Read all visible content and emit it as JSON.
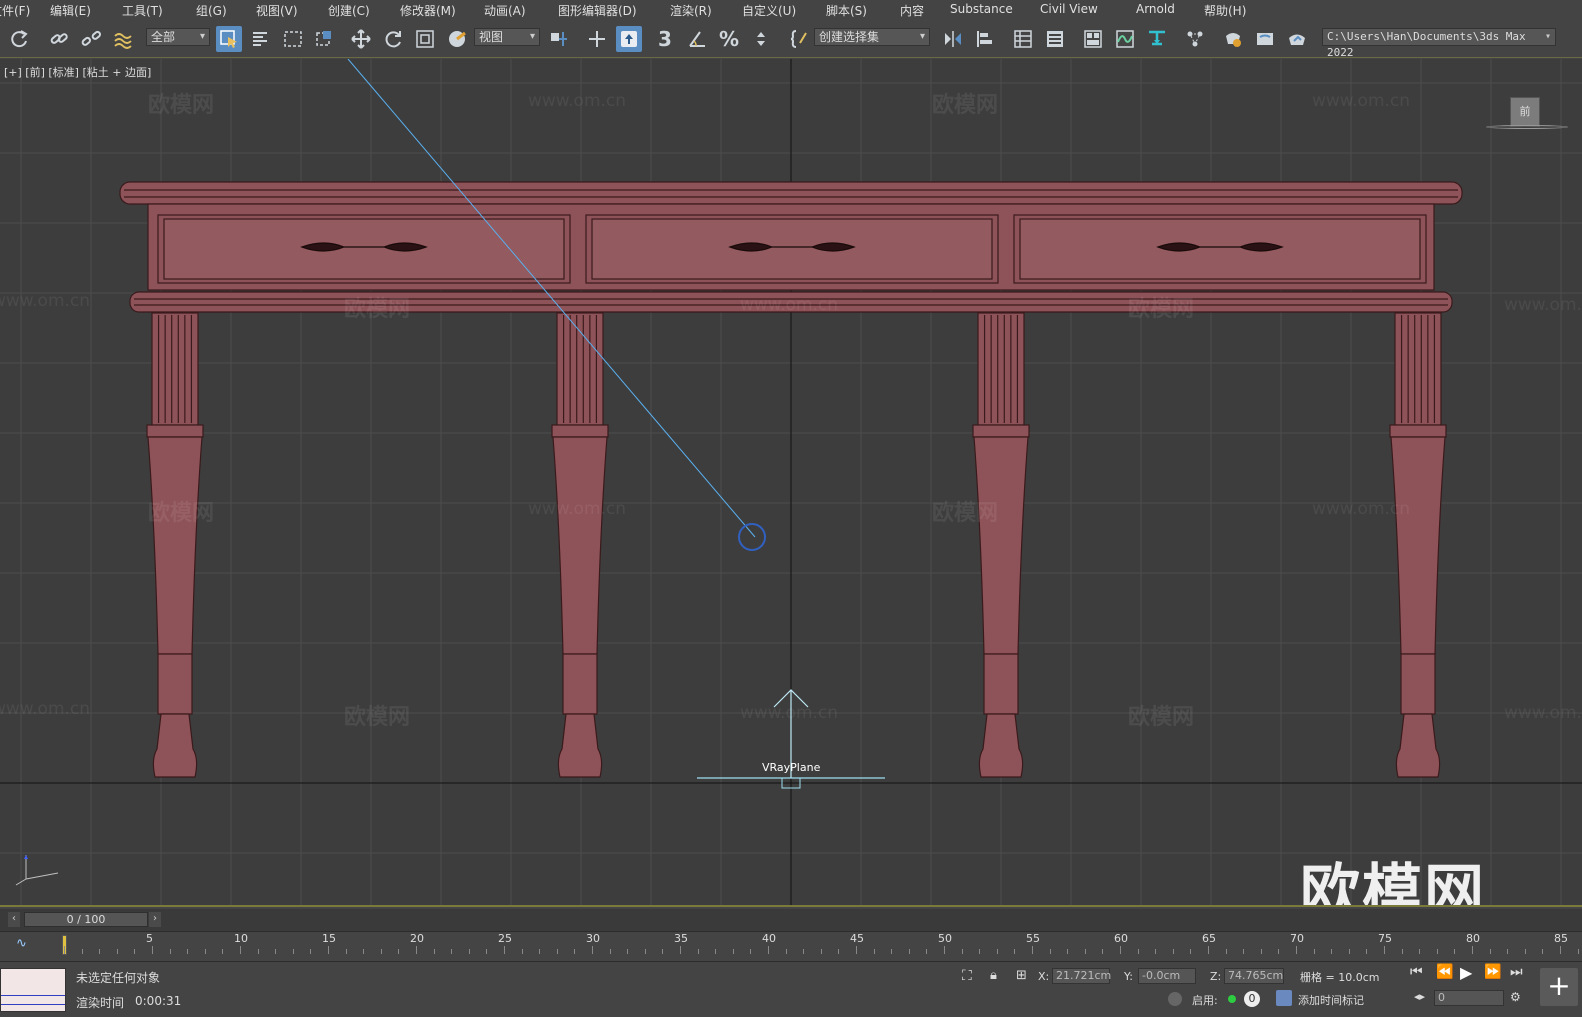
{
  "menu": [
    "文件(F)",
    "编辑(E)",
    "工具(T)",
    "组(G)",
    "视图(V)",
    "创建(C)",
    "修改器(M)",
    "动画(A)",
    "图形编辑器(D)",
    "渲染(R)",
    "自定义(U)",
    "脚本(S)",
    "内容",
    "Substance",
    "Civil View",
    "Arnold",
    "帮助(H)"
  ],
  "toolbar": {
    "filter_value": "全部",
    "refcoord_value": "视图",
    "named_selset_value": "创建选择集",
    "path_value": "C:\\Users\\Han\\Documents\\3ds Max 2022",
    "snaps_label": "3"
  },
  "viewport": {
    "label": "[+] [前] [标准] [粘土 + 边面]",
    "object_label": "VRayPlane",
    "watermark_text": "欧模网",
    "watermark_url": "www.om.cn",
    "big_watermark": "欧模网",
    "viewcube_label": "前"
  },
  "timeline": {
    "slider_value": "0 / 100",
    "ticks": [
      "5",
      "10",
      "15",
      "20",
      "25",
      "30",
      "35",
      "40",
      "45",
      "50",
      "55",
      "60",
      "65",
      "70",
      "75",
      "80",
      "85"
    ]
  },
  "status": {
    "selection_text": "未选定任何对象",
    "render_time_label": "渲染时间",
    "render_time_value": "0:00:31",
    "x_label": "X:",
    "x_value": "21.721cm",
    "y_label": "Y:",
    "y_value": "-0.0cm",
    "z_label": "Z:",
    "z_value": "74.765cm",
    "grid_text": "栅格 = 10.0cm",
    "enable_label": "启用:",
    "enable_count": "0",
    "add_time_tag": "添加时间标记",
    "frame_value": "0"
  },
  "colors": {
    "model": "#8e5358",
    "model_edge": "#3a1a1c",
    "selection_accent": "#5a8ec2"
  }
}
